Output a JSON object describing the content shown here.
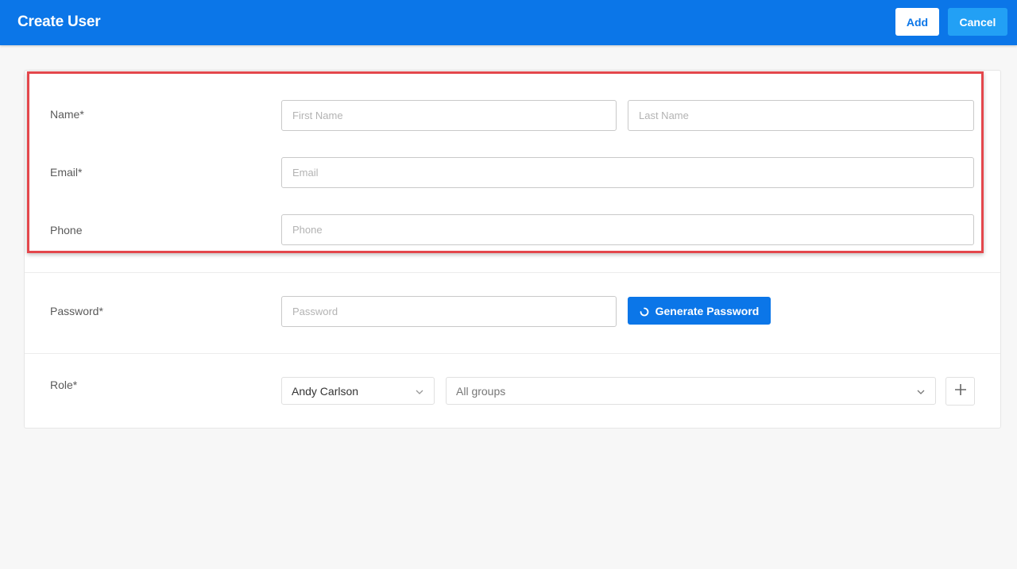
{
  "header": {
    "title": "Create User",
    "add_label": "Add",
    "cancel_label": "Cancel"
  },
  "form": {
    "name": {
      "label": "Name*",
      "first_placeholder": "First Name",
      "last_placeholder": "Last Name"
    },
    "email": {
      "label": "Email*",
      "placeholder": "Email"
    },
    "phone": {
      "label": "Phone",
      "placeholder": "Phone"
    },
    "password": {
      "label": "Password*",
      "placeholder": "Password",
      "generate_label": "Generate Password",
      "generate_icon": "refresh-icon"
    },
    "role": {
      "label": "Role*",
      "user_value": "Andy Carlson",
      "groups_value": "All groups",
      "add_icon": "plus-icon"
    }
  },
  "colors": {
    "primary": "#0b76e8",
    "cancel": "#22a0f5",
    "highlight": "#e4474c"
  }
}
